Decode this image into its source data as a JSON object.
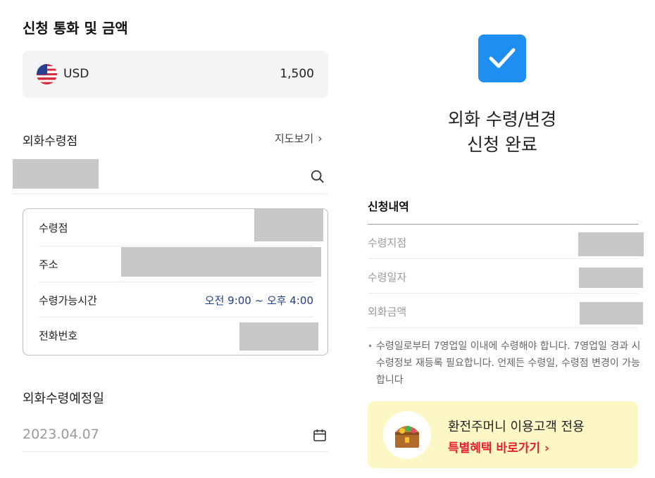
{
  "left": {
    "title": "신청 통화 및 금액",
    "currency": {
      "code": "USD",
      "amount": "1,500",
      "flag_icon": "us-flag-icon"
    },
    "branch": {
      "label": "외화수령점",
      "map_link": "지도보기",
      "search_icon": "search-icon"
    },
    "info": {
      "rows": [
        {
          "label": "수령점"
        },
        {
          "label": "주소"
        },
        {
          "label": "수령가능시간",
          "value": "오전 9:00 ~ 오후 4:00"
        },
        {
          "label": "전화번호"
        }
      ]
    },
    "date": {
      "label": "외화수령예정일",
      "value": "2023.04.07",
      "calendar_icon": "calendar-icon"
    }
  },
  "right": {
    "check_icon": "checkmark-icon",
    "done_title_line1": "외화 수령/변경",
    "done_title_line2": "신청 완료",
    "history": {
      "title": "신청내역",
      "rows": [
        {
          "label": "수령지점"
        },
        {
          "label": "수령일자"
        },
        {
          "label": "외화금액"
        }
      ]
    },
    "notice": "수령일로부터 7영업일 이내에 수령해야 합니다. 7영업일 경과 시 수령정보 재등록 필요합니다. 언제든 수령일, 수령점 변경이 가능합니다",
    "promo": {
      "line1": "환전주머니 이용고객 전용",
      "line2": "특별혜택 바로가기",
      "icon": "treasure-chest-icon",
      "accent_color": "#e8202f",
      "bg_color": "#fdf7c6"
    }
  },
  "colors": {
    "check_blue": "#1e8ff0",
    "hours_blue": "#1d3f8a"
  }
}
